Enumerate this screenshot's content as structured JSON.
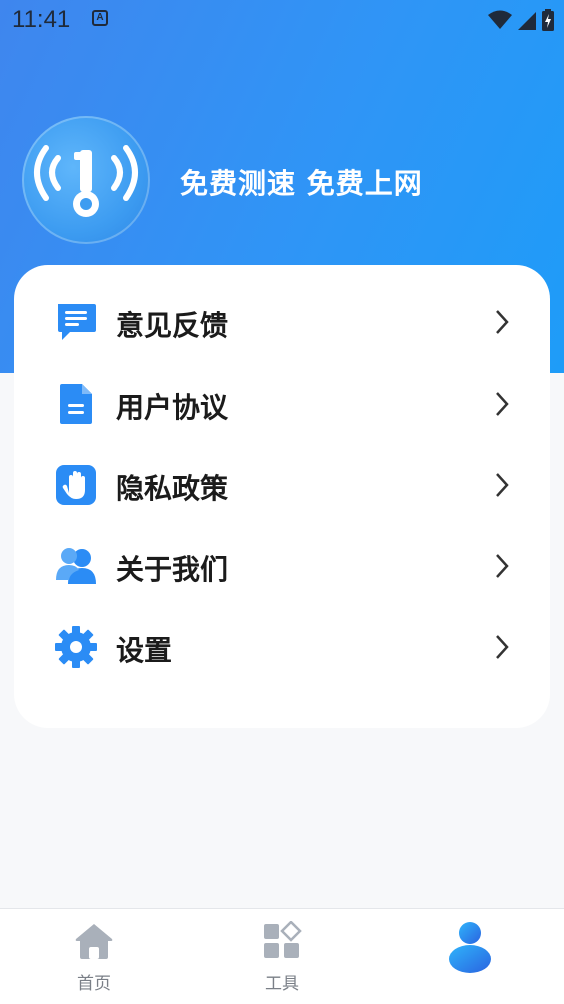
{
  "status_bar": {
    "time": "11:41",
    "notification_letter": "A"
  },
  "header": {
    "slogan": "免费测速 免费上网",
    "logo_icon": "wifi-key-icon"
  },
  "menu": {
    "items": [
      {
        "label": "意见反馈",
        "icon": "feedback-chat-icon"
      },
      {
        "label": "用户协议",
        "icon": "document-icon"
      },
      {
        "label": "隐私政策",
        "icon": "hand-shield-icon"
      },
      {
        "label": "关于我们",
        "icon": "users-icon"
      },
      {
        "label": "设置",
        "icon": "gear-icon"
      }
    ]
  },
  "tabbar": {
    "tabs": [
      {
        "label": "首页",
        "icon": "home-icon"
      },
      {
        "label": "工具",
        "icon": "tools-grid-icon"
      },
      {
        "label": "",
        "icon": "profile-icon",
        "active": true
      }
    ]
  },
  "colors": {
    "accent": "#2f95f6",
    "icon_blue": "#2b8cf5",
    "tab_inactive": "#a9b0ba"
  }
}
